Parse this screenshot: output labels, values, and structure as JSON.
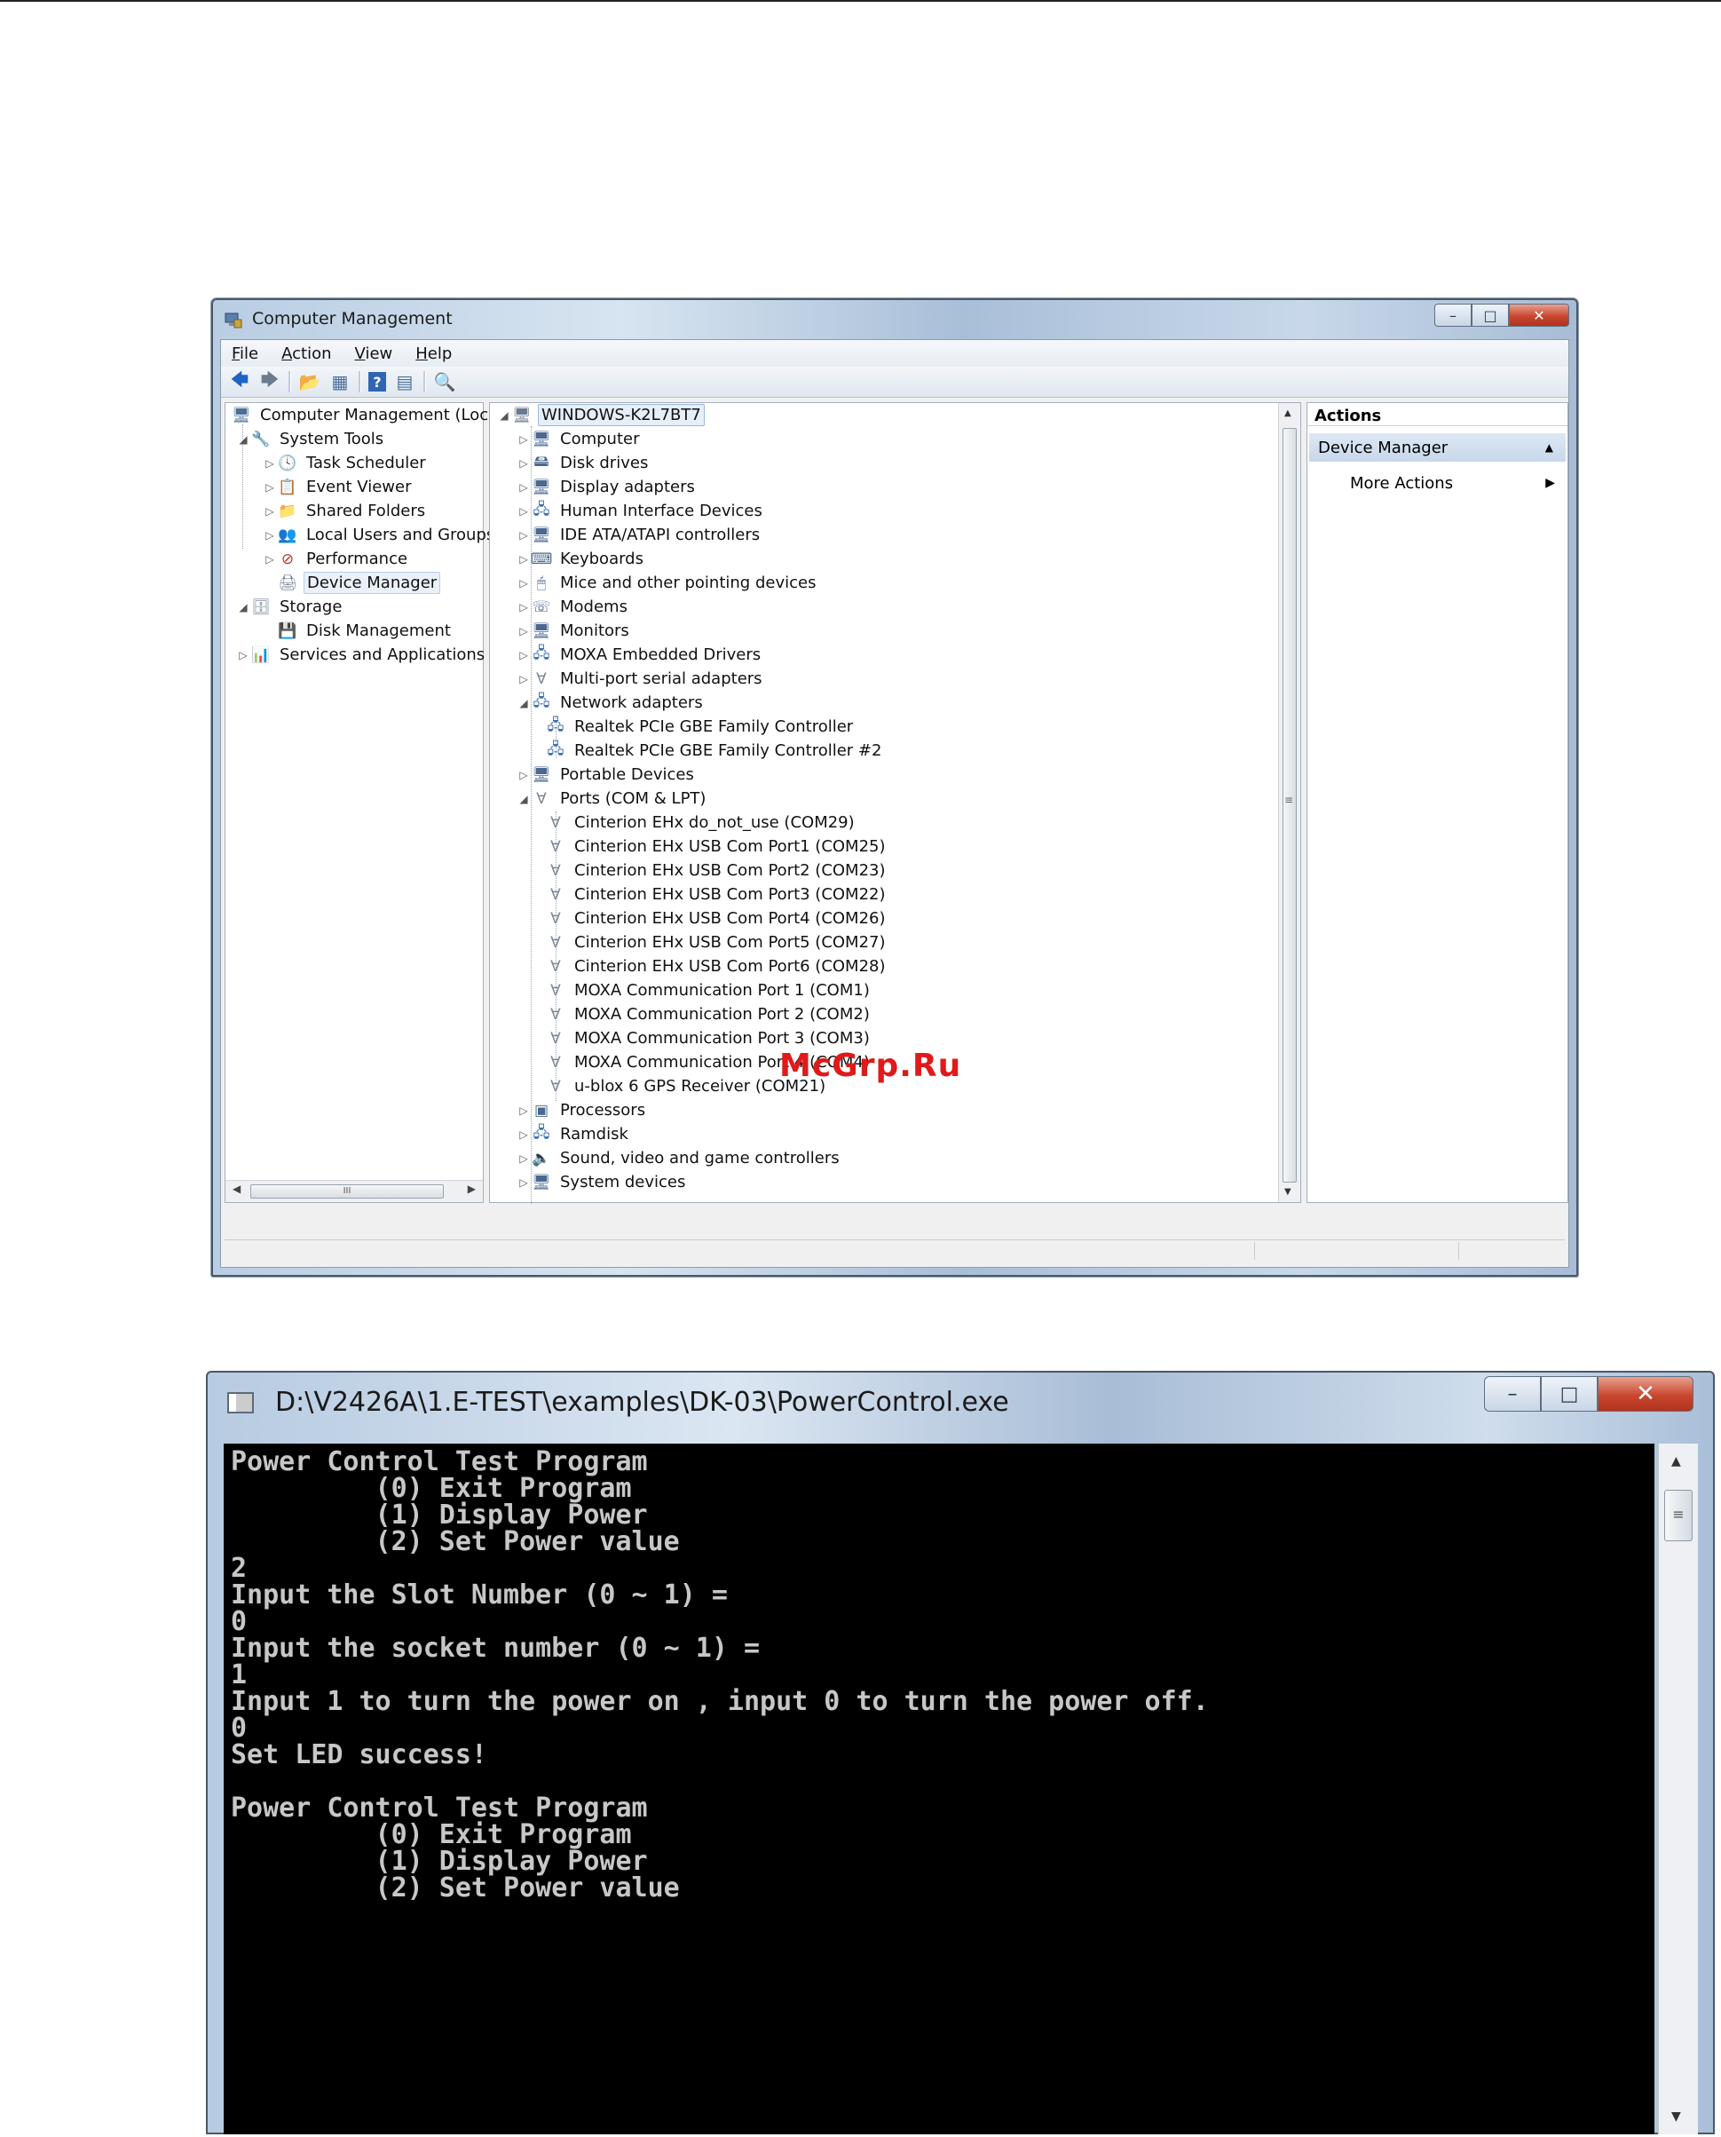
{
  "computer_management": {
    "title": "Computer Management",
    "menu": [
      "File",
      "Action",
      "View",
      "Help"
    ],
    "left_tree": [
      {
        "label": "Computer Management (Local",
        "level": 0,
        "icon": "computer-management-icon"
      },
      {
        "label": "System Tools",
        "level": 1,
        "icon": "tools-icon"
      },
      {
        "label": "Task Scheduler",
        "level": 2,
        "icon": "clock-icon"
      },
      {
        "label": "Event Viewer",
        "level": 2,
        "icon": "event-viewer-icon"
      },
      {
        "label": "Shared Folders",
        "level": 2,
        "icon": "shared-folder-icon"
      },
      {
        "label": "Local Users and Groups",
        "level": 2,
        "icon": "users-icon"
      },
      {
        "label": "Performance",
        "level": 2,
        "icon": "performance-icon"
      },
      {
        "label": "Device Manager",
        "level": 2,
        "icon": "device-manager-icon",
        "selected": true
      },
      {
        "label": "Storage",
        "level": 1,
        "icon": "storage-icon"
      },
      {
        "label": "Disk Management",
        "level": 2,
        "icon": "disk-icon"
      },
      {
        "label": "Services and Applications",
        "level": 1,
        "icon": "services-icon"
      }
    ],
    "device_tree": {
      "root": "WINDOWS-K2L7BT7",
      "items": [
        {
          "label": "Computer",
          "level": 1
        },
        {
          "label": "Disk drives",
          "level": 1
        },
        {
          "label": "Display adapters",
          "level": 1
        },
        {
          "label": "Human Interface Devices",
          "level": 1
        },
        {
          "label": "IDE ATA/ATAPI controllers",
          "level": 1
        },
        {
          "label": "Keyboards",
          "level": 1
        },
        {
          "label": "Mice and other pointing devices",
          "level": 1
        },
        {
          "label": "Modems",
          "level": 1
        },
        {
          "label": "Monitors",
          "level": 1
        },
        {
          "label": "MOXA Embedded Drivers",
          "level": 1
        },
        {
          "label": "Multi-port serial adapters",
          "level": 1
        },
        {
          "label": "Network adapters",
          "level": 1,
          "expanded": true
        },
        {
          "label": "Realtek PCIe GBE Family Controller",
          "level": 2
        },
        {
          "label": "Realtek PCIe GBE Family Controller #2",
          "level": 2
        },
        {
          "label": "Portable Devices",
          "level": 1
        },
        {
          "label": "Ports (COM & LPT)",
          "level": 1,
          "expanded": true
        },
        {
          "label": "Cinterion EHx do_not_use (COM29)",
          "level": 2
        },
        {
          "label": "Cinterion EHx USB Com Port1 (COM25)",
          "level": 2
        },
        {
          "label": "Cinterion EHx USB Com Port2 (COM23)",
          "level": 2
        },
        {
          "label": "Cinterion EHx USB Com Port3 (COM22)",
          "level": 2
        },
        {
          "label": "Cinterion EHx USB Com Port4 (COM26)",
          "level": 2
        },
        {
          "label": "Cinterion EHx USB Com Port5 (COM27)",
          "level": 2
        },
        {
          "label": "Cinterion EHx USB Com Port6 (COM28)",
          "level": 2
        },
        {
          "label": "MOXA Communication Port 1 (COM1)",
          "level": 2
        },
        {
          "label": "MOXA Communication Port 2 (COM2)",
          "level": 2
        },
        {
          "label": "MOXA Communication Port 3 (COM3)",
          "level": 2
        },
        {
          "label": "MOXA Communication Port 4 (COM4)",
          "level": 2
        },
        {
          "label": "u-blox 6 GPS Receiver (COM21)",
          "level": 2
        },
        {
          "label": "Processors",
          "level": 1
        },
        {
          "label": "Ramdisk",
          "level": 1
        },
        {
          "label": "Sound, video and game controllers",
          "level": 1
        },
        {
          "label": "System devices",
          "level": 1
        }
      ]
    },
    "actions": {
      "title": "Actions",
      "section": "Device Manager",
      "item": "More Actions"
    },
    "left_scroll_grip": "III",
    "watermark": "McGrp.Ru"
  },
  "console": {
    "title": "D:\\V2426A\\1.E-TEST\\examples\\DK-03\\PowerControl.exe",
    "lines": [
      "Power Control Test Program",
      "         (0) Exit Program",
      "         (1) Display Power",
      "         (2) Set Power value",
      "2",
      "Input the Slot Number (0 ~ 1) =",
      "0",
      "Input the socket number (0 ~ 1) =",
      "1",
      "Input 1 to turn the power on , input 0 to turn the power off.",
      "0",
      "Set LED success!",
      "",
      "Power Control Test Program",
      "         (0) Exit Program",
      "         (1) Display Power",
      "         (2) Set Power value"
    ],
    "colors": {
      "background": "#000000",
      "text": "#c7c7c7"
    }
  }
}
